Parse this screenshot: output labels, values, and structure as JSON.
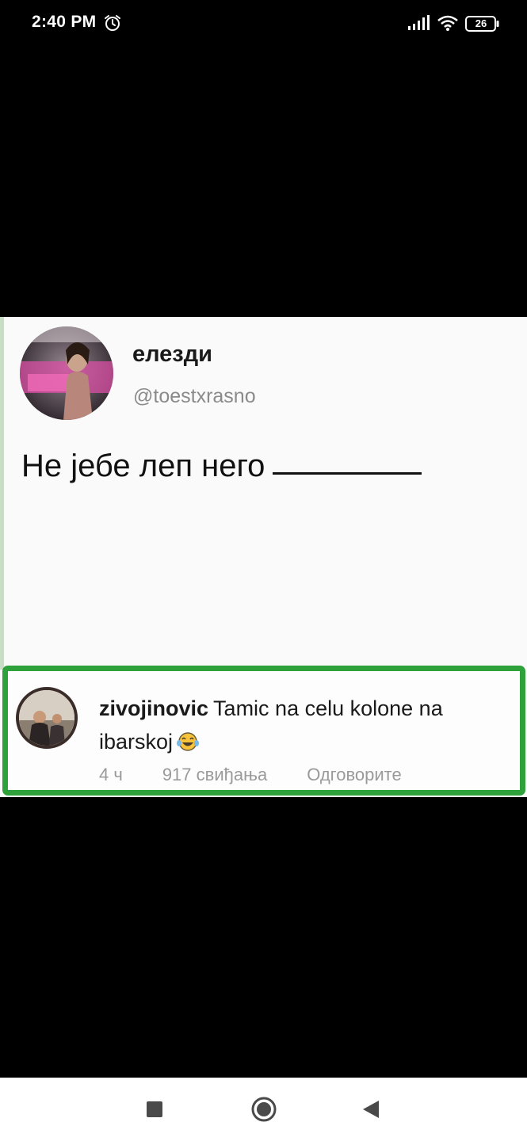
{
  "status_bar": {
    "time": "2:40 PM",
    "battery": "26",
    "icons": [
      "alarm-icon",
      "signal-icon",
      "wifi-icon",
      "battery-icon"
    ]
  },
  "post": {
    "display_name": "елезди",
    "handle": "@toestxrasno",
    "text": "Не јебе леп него"
  },
  "comment": {
    "username": "zivojinovic",
    "text": "Tamic na celu kolone na ibarskoj",
    "emoji": "laughing-tears-emoji",
    "time": "4 ч",
    "likes": "917 свиђања",
    "reply_label": "Одговорите",
    "highlight_color": "#2ea13a"
  },
  "nav_bar": {
    "buttons": [
      "recents-button",
      "home-button",
      "back-button"
    ]
  }
}
